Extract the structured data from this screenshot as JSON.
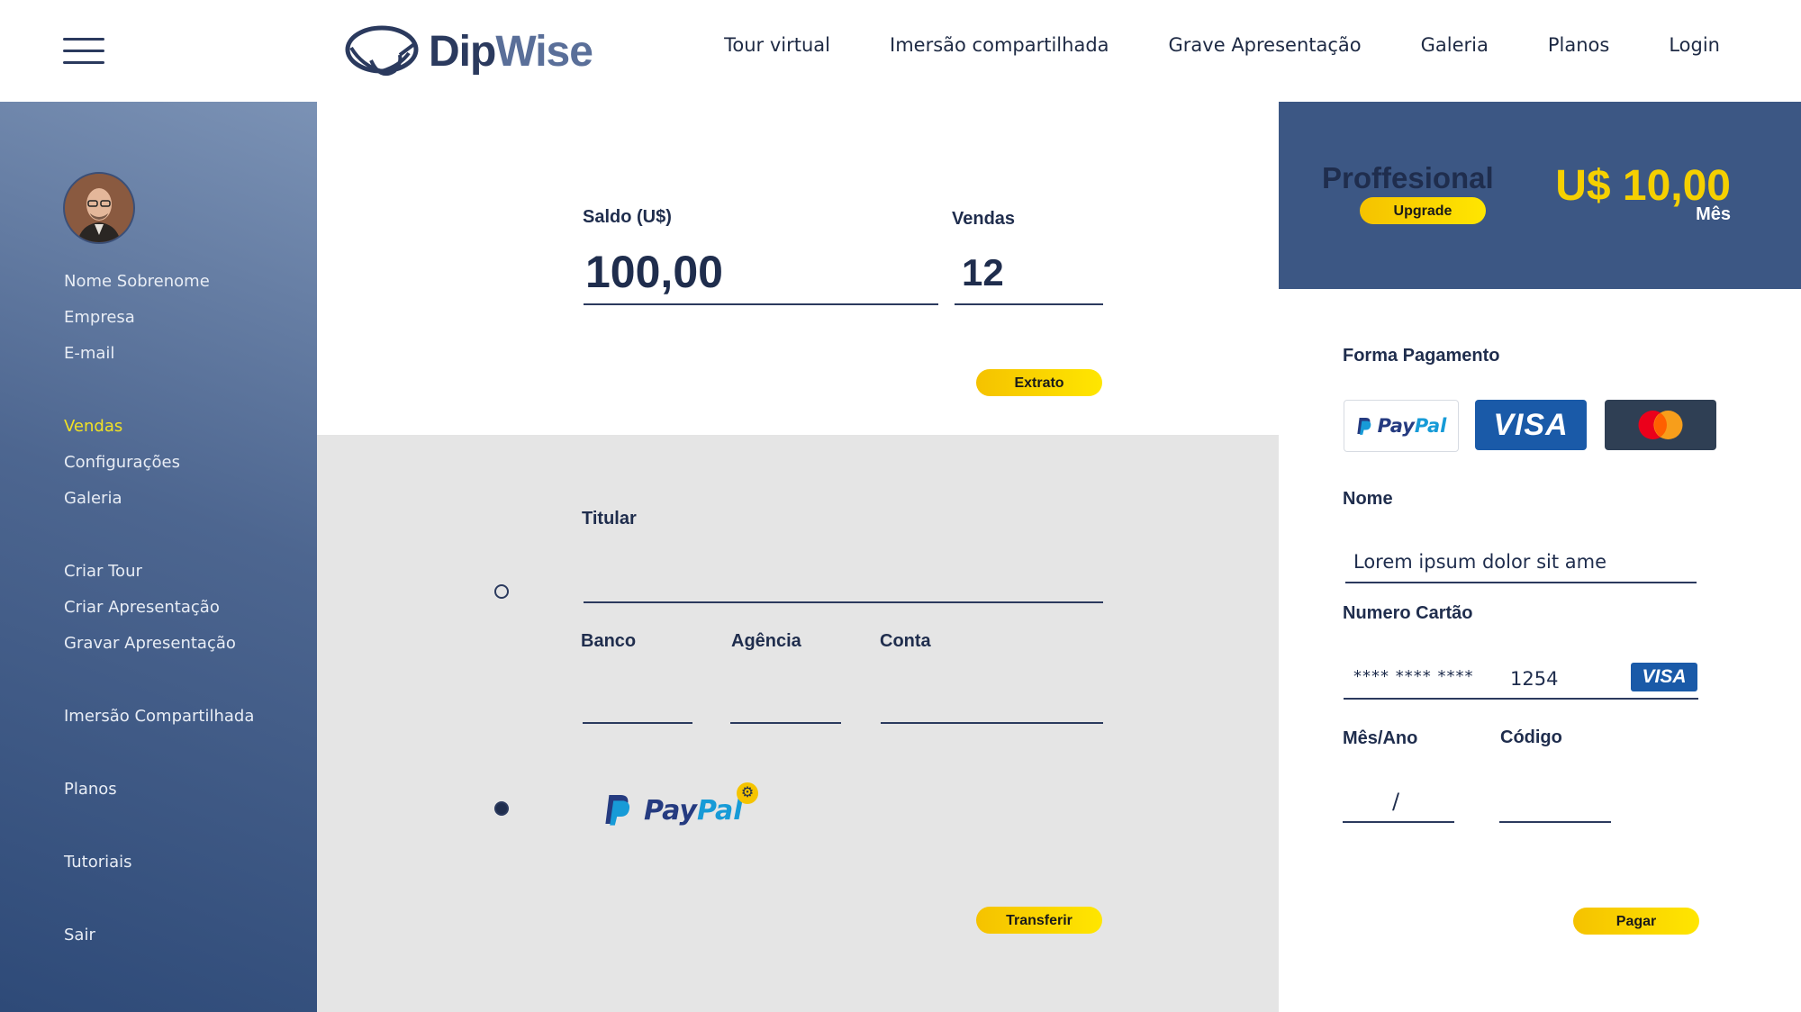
{
  "header": {
    "logo_dip": "Dip",
    "logo_wise": "Wise",
    "nav": [
      "Tour virtual",
      "Imersão compartilhada",
      "Grave Apresentação",
      "Galeria",
      "Planos",
      "Login"
    ]
  },
  "sidebar": {
    "profile": [
      "Nome Sobrenome",
      "Empresa",
      "E-mail"
    ],
    "items": [
      "Vendas",
      "Configurações",
      "Galeria",
      "Criar Tour",
      "Criar Apresentação",
      "Gravar Apresentação",
      "Imersão Compartilhada",
      "Planos",
      "Tutoriais",
      "Sair"
    ],
    "active_item": "Vendas"
  },
  "summary": {
    "balance_label": "Saldo (U$)",
    "balance_value": "100,00",
    "sales_label": "Vendas",
    "sales_value": "12",
    "statement_button": "Extrato"
  },
  "transfer": {
    "holder_label": "Titular",
    "bank_label": "Banco",
    "agency_label": "Agência",
    "account_label": "Conta",
    "paypal_option": "PayPal",
    "transfer_button": "Transferir"
  },
  "plan": {
    "name": "Proffesional",
    "upgrade_button": "Upgrade",
    "price": "U$ 10,00",
    "period": "Mês"
  },
  "payment": {
    "method_label": "Forma Pagamento",
    "methods": [
      "PayPal",
      "VISA",
      "Mastercard"
    ],
    "name_label": "Nome",
    "name_value": "Lorem ipsum dolor sit ame",
    "card_label": "Numero Cartão",
    "card_mask": "****  ****  ****",
    "card_last4": "1254",
    "card_brand": "VISA",
    "expiry_label": "Mês/Ano",
    "expiry_sep": "/",
    "code_label": "Código",
    "pay_button": "Pagar"
  },
  "colors": {
    "accent_yellow": "#ffd500",
    "navy": "#1f2d4d",
    "sidebar": "#4d6690",
    "plan_band": "#3c5784",
    "active_item": "#f2e224"
  }
}
